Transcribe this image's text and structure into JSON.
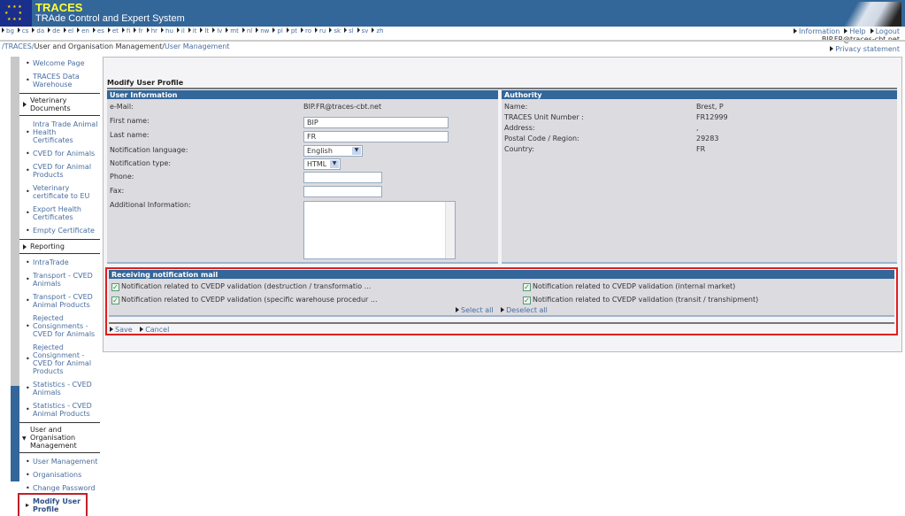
{
  "header": {
    "title": "TRACES",
    "subtitle": "TRAde Control and Expert System"
  },
  "languages": [
    "bg",
    "cs",
    "da",
    "de",
    "el",
    "en",
    "es",
    "et",
    "fi",
    "fr",
    "hr",
    "hu",
    "il",
    "it",
    "lt",
    "lv",
    "mt",
    "nl",
    "nw",
    "pl",
    "pt",
    "ro",
    "ru",
    "sk",
    "sl",
    "sv",
    "zh"
  ],
  "top_links": [
    "Information",
    "Help",
    "Logout"
  ],
  "user_email": "BIP.FR@traces-cbt.net",
  "privacy": "Privacy statement",
  "breadcrumb": {
    "root": "/TRACES/",
    "middle": "User and Organisation Management/",
    "current": "User Management"
  },
  "sidebar": [
    {
      "label": "Welcome Page",
      "type": "link"
    },
    {
      "label": "TRACES Data Warehouse",
      "type": "link"
    },
    {
      "label": "Veterinary Documents",
      "type": "section"
    },
    {
      "label": "Intra Trade Animal Health Certificates",
      "type": "link"
    },
    {
      "label": "CVED for Animals",
      "type": "link"
    },
    {
      "label": "CVED for Animal Products",
      "type": "link"
    },
    {
      "label": "Veterinary certificate to EU",
      "type": "link"
    },
    {
      "label": "Export Health Certificates",
      "type": "link"
    },
    {
      "label": "Empty Certificate",
      "type": "link"
    },
    {
      "label": "Reporting",
      "type": "section"
    },
    {
      "label": "IntraTrade",
      "type": "link"
    },
    {
      "label": "Transport - CVED Animals",
      "type": "link"
    },
    {
      "label": "Transport - CVED Animal Products",
      "type": "link"
    },
    {
      "label": "Rejected Consignments - CVED for Animals",
      "type": "link"
    },
    {
      "label": "Rejected Consignment - CVED for Animal Products",
      "type": "link"
    },
    {
      "label": "Statistics - CVED Animals",
      "type": "link"
    },
    {
      "label": "Statistics - CVED Animal Products",
      "type": "link"
    },
    {
      "label": "User and Organisation Management",
      "type": "section-open"
    },
    {
      "label": "User Management",
      "type": "link"
    },
    {
      "label": "Organisations",
      "type": "link"
    },
    {
      "label": "Change Password",
      "type": "link"
    },
    {
      "label": "Modify User Profile",
      "type": "active"
    }
  ],
  "page_title": "Modify User Profile",
  "user_info": {
    "heading": "User Information",
    "email_label": "e-Mail:",
    "email": "BIP.FR@traces-cbt.net",
    "first_name_label": "First name:",
    "first_name": "BIP",
    "last_name_label": "Last name:",
    "last_name": "FR",
    "lang_label": "Notification language:",
    "lang": "English",
    "type_label": "Notification type:",
    "type": "HTML",
    "phone_label": "Phone:",
    "phone": "",
    "fax_label": "Fax:",
    "fax": "",
    "info_label": "Additional Information:",
    "info": ""
  },
  "authority": {
    "heading": "Authority",
    "rows": [
      {
        "label": "Name:",
        "value": "Brest, P"
      },
      {
        "label": "TRACES Unit Number :",
        "value": "FR12999"
      },
      {
        "label": "Address:",
        "value": ","
      },
      {
        "label": "Postal Code / Region:",
        "value": "29283"
      },
      {
        "label": "Country:",
        "value": "FR"
      }
    ]
  },
  "notifications": {
    "heading": "Receiving notification mail",
    "items": [
      {
        "label": "Notification related to CVEDP validation (destruction / transformatio ...",
        "checked": true
      },
      {
        "label": "Notification related to CVEDP validation (internal market)",
        "checked": true
      },
      {
        "label": "Notification related to CVEDP validation (specific warehouse procedur ...",
        "checked": true
      },
      {
        "label": "Notification related to CVEDP validation (transit / transhipment)",
        "checked": true
      }
    ],
    "select_all": "Select all",
    "deselect_all": "Deselect all"
  },
  "actions": {
    "save": "Save",
    "cancel": "Cancel"
  },
  "colors": {
    "header": "#336699",
    "highlight": "#e02020",
    "panel": "#dcdbe0"
  }
}
